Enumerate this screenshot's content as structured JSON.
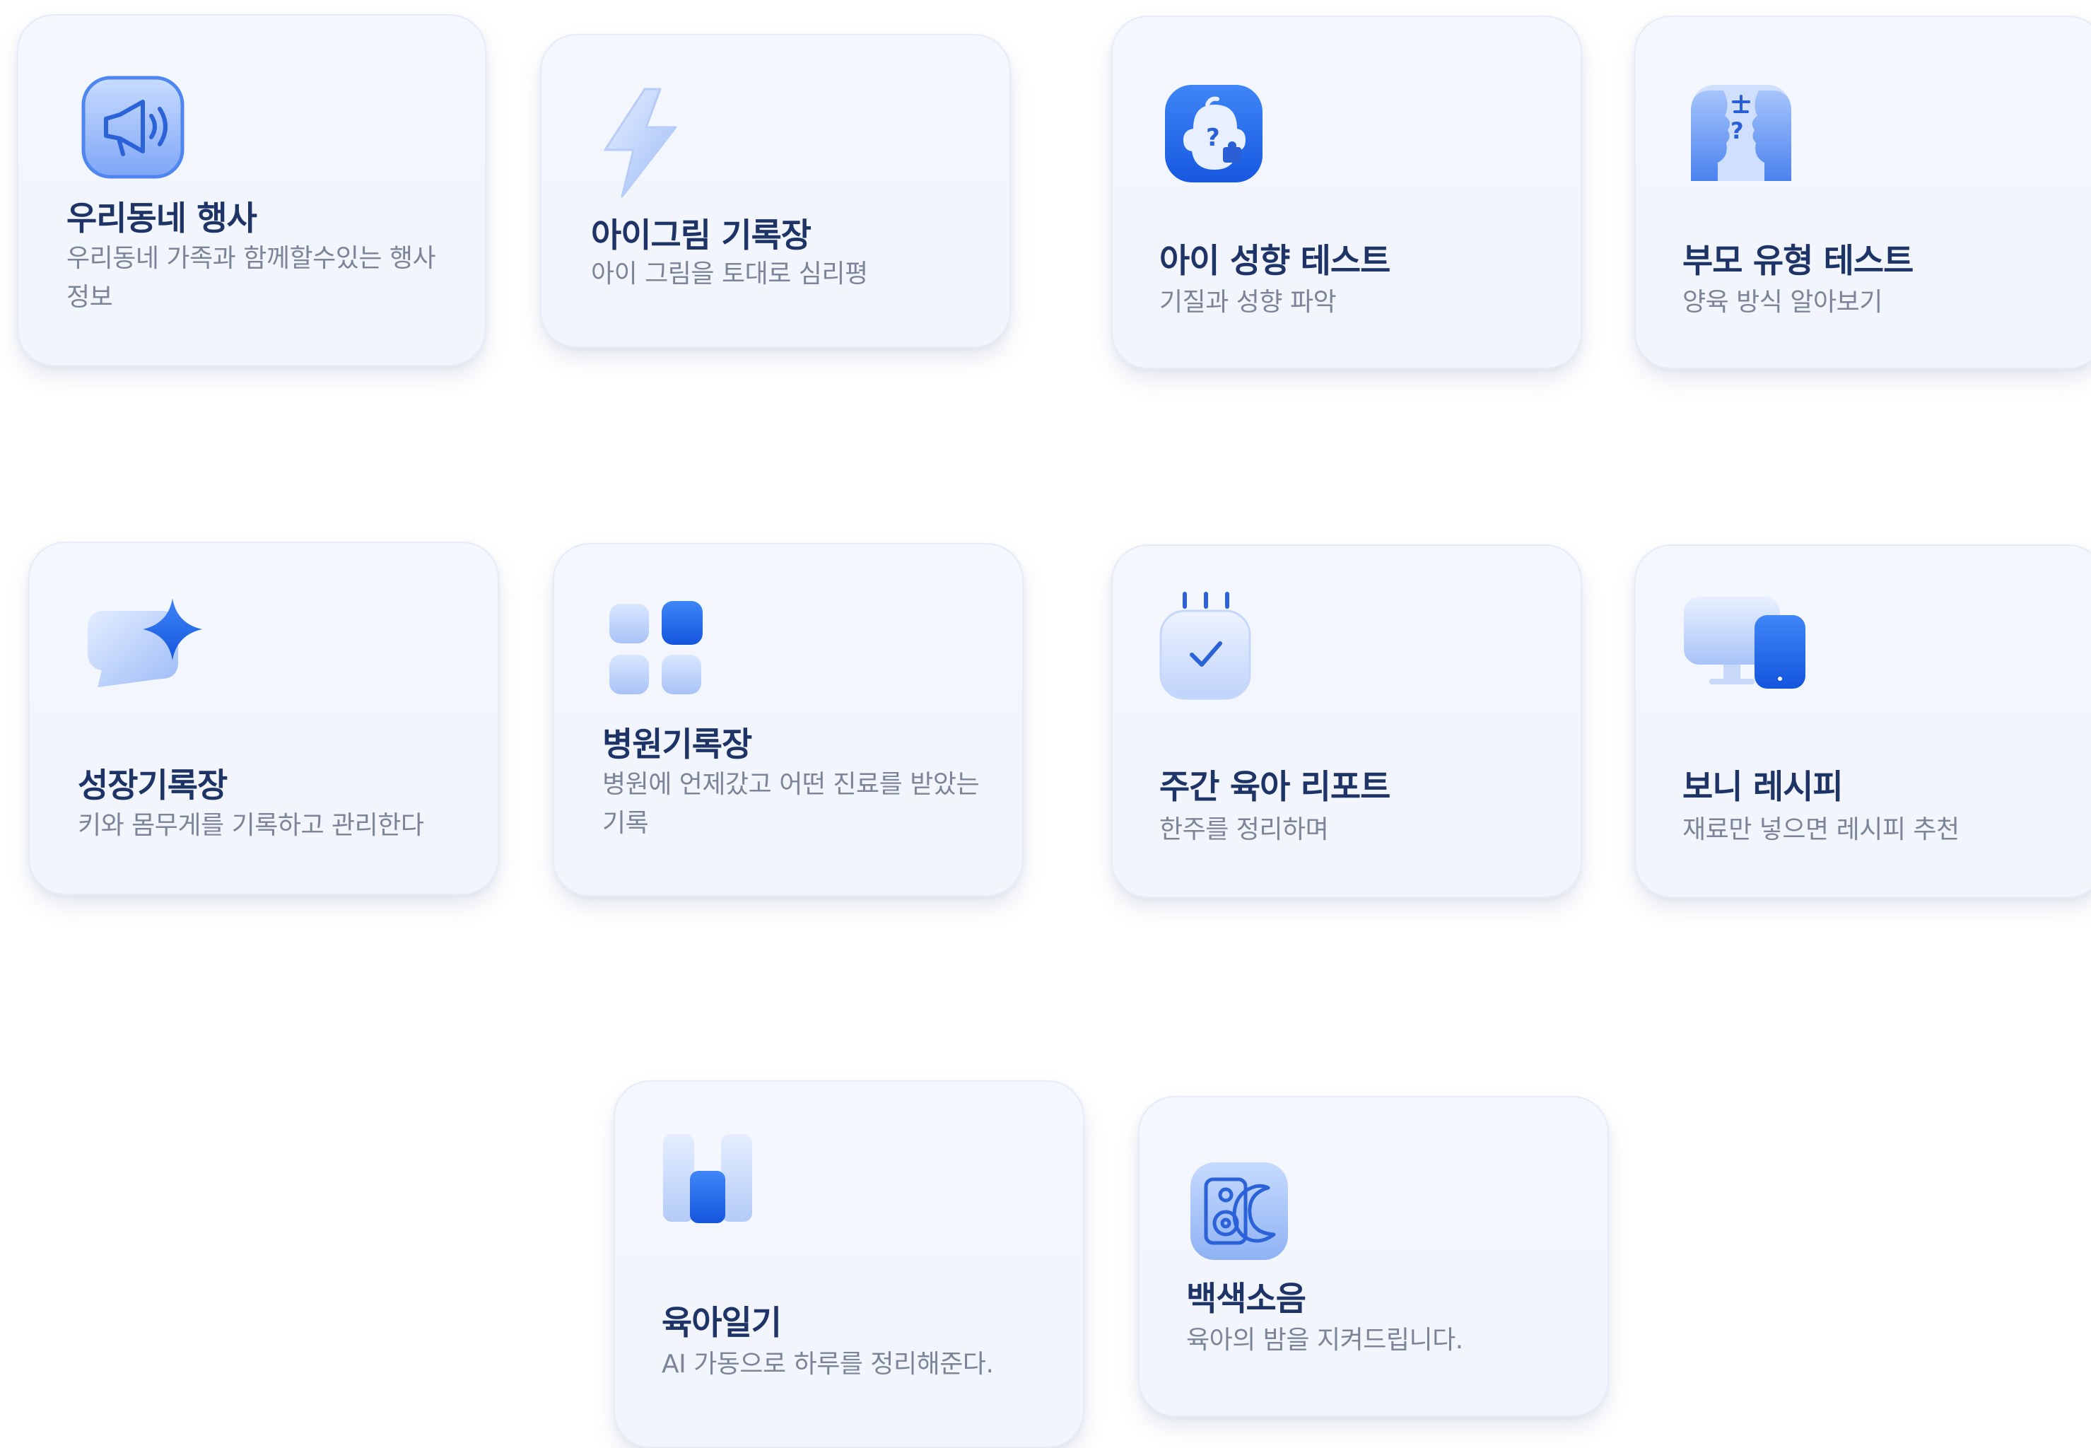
{
  "cards": [
    {
      "title": "우리동네 행사",
      "desc": "우리동네 가족과 함께할수있는 행사 정보",
      "icon": "megaphone-icon"
    },
    {
      "title": "아이그림 기록장",
      "desc": "아이 그림을 토대로 심리평",
      "icon": "lightning-icon"
    },
    {
      "title": "아이 성향 테스트",
      "desc": "기질과 성향 파악",
      "icon": "baby-face-puzzle-icon"
    },
    {
      "title": "부모 유형 테스트",
      "desc": "양육 방식 알아보기",
      "icon": "parents-profile-icon"
    },
    {
      "title": "성장기록장",
      "desc": "키와 몸무게를 기록하고 관리한다",
      "icon": "sparkle-chat-icon"
    },
    {
      "title": "병원기록장",
      "desc": "병원에 언제갔고 어떤 진료를 받았는 기록",
      "icon": "app-grid-icon"
    },
    {
      "title": "주간 육아 리포트",
      "desc": "한주를 정리하며",
      "icon": "calendar-check-icon"
    },
    {
      "title": "보니 레시피",
      "desc": "재료만 넣으면 레시피 추천",
      "icon": "devices-icon"
    },
    {
      "title": "육아일기",
      "desc": "AI 가동으로 하루를 정리해준다.",
      "icon": "journal-icon"
    },
    {
      "title": "백색소음",
      "desc": "육아의 밤을 지켜드립니다.",
      "icon": "speaker-moon-icon"
    }
  ],
  "colors": {
    "accent": "#1e63f0",
    "title": "#1f3466",
    "desc": "#7c8598",
    "card_bg": "#f3f6fd"
  }
}
